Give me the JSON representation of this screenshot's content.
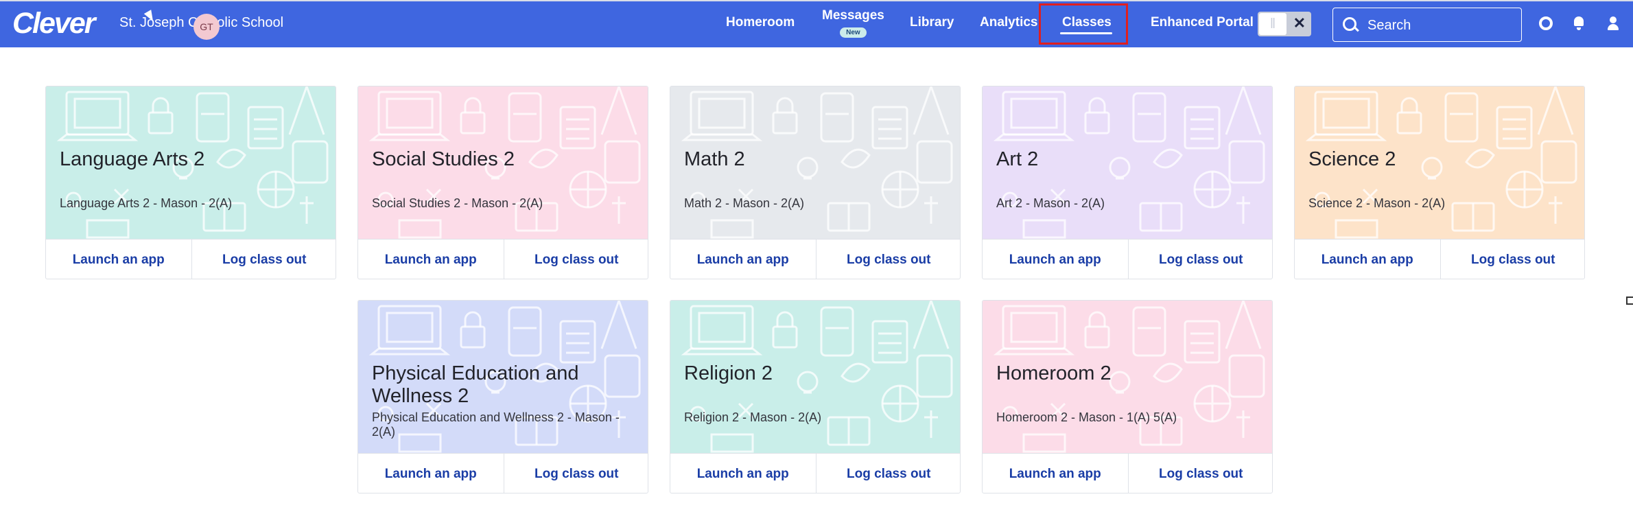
{
  "header": {
    "logo": "Clever",
    "school_name": "St. Joseph Catholic School",
    "avatar_initials": "GT",
    "nav": [
      {
        "label": "Homeroom"
      },
      {
        "label": "Messages",
        "badge": "New"
      },
      {
        "label": "Library"
      },
      {
        "label": "Analytics"
      },
      {
        "label": "Classes"
      }
    ],
    "enhanced_portal_label": "Enhanced Portal",
    "search_placeholder": "Search",
    "colors": {
      "bar": "#3f66e0",
      "active_outline": "#e01f1f",
      "action_link": "#1a3da6"
    }
  },
  "classes": [
    {
      "title": "Language Arts 2",
      "subtitle": "Language Arts 2 - Mason - 2(A)",
      "color": "#c9eee9",
      "launch": "Launch an app",
      "logout": "Log class out"
    },
    {
      "title": "Social Studies 2",
      "subtitle": "Social Studies 2 - Mason - 2(A)",
      "color": "#fcdce8",
      "launch": "Launch an app",
      "logout": "Log class out"
    },
    {
      "title": "Math 2",
      "subtitle": "Math 2 - Mason - 2(A)",
      "color": "#e6e9ed",
      "launch": "Launch an app",
      "logout": "Log class out"
    },
    {
      "title": "Art 2",
      "subtitle": "Art 2 - Mason - 2(A)",
      "color": "#e9def9",
      "launch": "Launch an app",
      "logout": "Log class out"
    },
    {
      "title": "Science 2",
      "subtitle": "Science 2 - Mason - 2(A)",
      "color": "#fde3c9",
      "launch": "Launch an app",
      "logout": "Log class out"
    },
    {
      "title": "Physical Education and Wellness 2",
      "subtitle": "Physical Education and Wellness 2 - Mason - 2(A)",
      "color": "#d3dbf9",
      "launch": "Launch an app",
      "logout": "Log class out"
    },
    {
      "title": "Religion 2",
      "subtitle": "Religion 2 - Mason - 2(A)",
      "color": "#c9eee9",
      "launch": "Launch an app",
      "logout": "Log class out"
    },
    {
      "title": "Homeroom 2",
      "subtitle": "Homeroom 2 - Mason - 1(A) 5(A)",
      "color": "#fcdce8",
      "launch": "Launch an app",
      "logout": "Log class out"
    }
  ]
}
